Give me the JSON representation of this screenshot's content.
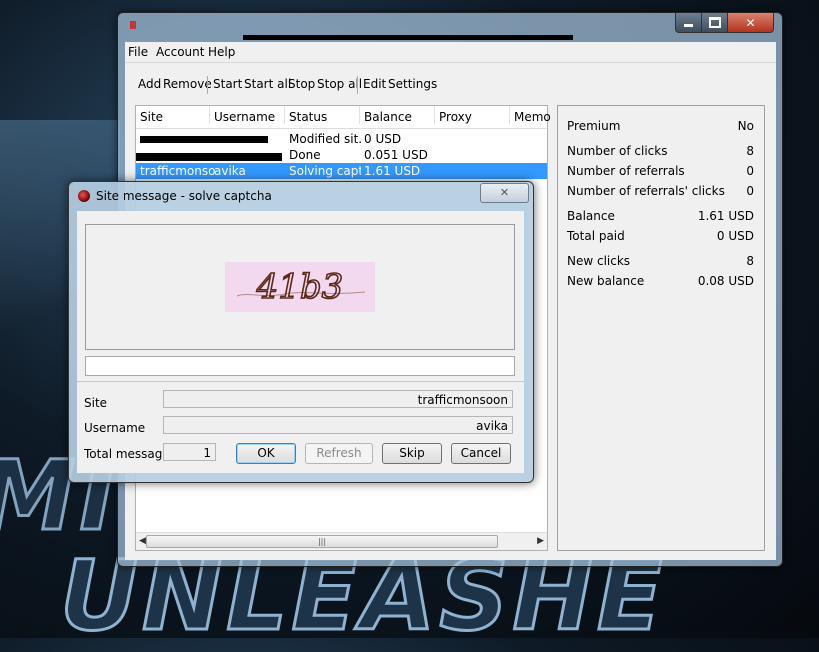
{
  "background": {
    "word_top": "MI",
    "word_bottom": "UNLEASHE"
  },
  "window": {
    "controls": {
      "minimize": "",
      "maximize": "",
      "close": "✕"
    }
  },
  "menu": [
    "File",
    "Account",
    "Help"
  ],
  "toolbar": {
    "add": "Add",
    "remove": "Remove",
    "start": "Start",
    "start_all": "Start all",
    "stop": "Stop",
    "stop_all": "Stop all",
    "edit": "Edit",
    "settings": "Settings"
  },
  "accounts": {
    "columns": [
      "Site",
      "Username",
      "Status",
      "Balance",
      "Proxy",
      "Memo"
    ],
    "rows": [
      {
        "site": "",
        "username": "",
        "status": "Modified sit...",
        "balance": "0 USD",
        "selected": false
      },
      {
        "site": "",
        "username": "",
        "status": "Done",
        "balance": "0.051 USD",
        "selected": false
      },
      {
        "site": "trafficmonsoon",
        "username": "avika",
        "status": "Solving capt...",
        "balance": "1.61 USD",
        "selected": true
      }
    ],
    "scroll_thumb": "|||"
  },
  "stats": [
    {
      "label": "Premium",
      "value": "No"
    },
    {
      "label": "Number of clicks",
      "value": "8"
    },
    {
      "label": "Number of referrals",
      "value": "0"
    },
    {
      "label": "Number of referrals' clicks",
      "value": "0"
    },
    {
      "label": "Balance",
      "value": "1.61 USD"
    },
    {
      "label": "Total paid",
      "value": "0 USD"
    },
    {
      "label": "New clicks",
      "value": "8"
    },
    {
      "label": "New balance",
      "value": "0.08 USD"
    }
  ],
  "dialog": {
    "title": "Site message - solve captcha",
    "close_icon": "✕",
    "captcha_text": "41b3",
    "captcha_input_value": "",
    "site_label": "Site",
    "site_value": "trafficmonsoon",
    "username_label": "Username",
    "username_value": "avika",
    "total_label": "Total messages",
    "total_value": "1",
    "buttons": {
      "ok": "OK",
      "refresh": "Refresh",
      "skip": "Skip",
      "cancel": "Cancel"
    }
  }
}
